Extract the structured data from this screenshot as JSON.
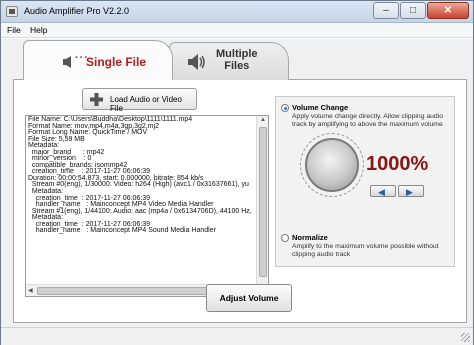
{
  "window": {
    "title": "Audio Amplifier Pro V2.2.0"
  },
  "menu": {
    "file": "File",
    "help": "Help"
  },
  "tabs": {
    "single": "Single File",
    "multiple_line1": "Multiple",
    "multiple_line2": "Files"
  },
  "load_button": {
    "label": "Load Audio or Video File"
  },
  "file_info": [
    "File Name: C:\\Users\\Buddha\\Desktop\\1111\\1111.mp4",
    "Format Name: mov,mp4,m4a,3gp,3g2,mj2",
    "Format Long Name: QuickTime / MOV",
    "File Size: 5,59 MB",
    "Metadata:",
    "  major_brand      : mp42",
    "  minor_version    : 0",
    "  compatible_brands: isommp42",
    "  creation_time    : 2017-11-27 06:06:39",
    "Duration: 00:00:54.873, start: 0.000000, bitrate: 854 kb/s",
    "  Stream #0(eng), 1/30000: Video: h264 (High) (avc1 / 0x31637661), yu",
    "  Metadata:",
    "    creation_time  : 2017-11-27 06:06:39",
    "    handler_name   : Mainconcept MP4 Video Media Handler",
    "  Stream #1(eng), 1/44100: Audio: aac (mp4a / 0x6134706D), 44100 Hz,",
    "  Metadata:",
    "    creation_time  : 2017-11-27 06:06:39",
    "    handler_name   : Mainconcept MP4 Sound Media Handler"
  ],
  "volume_change": {
    "title": "Volume Change",
    "description": "Apply volume change directly. Allow clipping audio track by amplifying to above the maximum volume",
    "percent": "1000%",
    "selected": true
  },
  "normalize": {
    "title": "Normalize",
    "description": "Amplify to the maximum volume possible without clipping audio track",
    "selected": false
  },
  "adjust_button": {
    "label": "Adjust Volume"
  },
  "colors": {
    "accent_red": "#b21e1e",
    "percent_red": "#8b1414",
    "radio_blue": "#2a6fd6"
  }
}
